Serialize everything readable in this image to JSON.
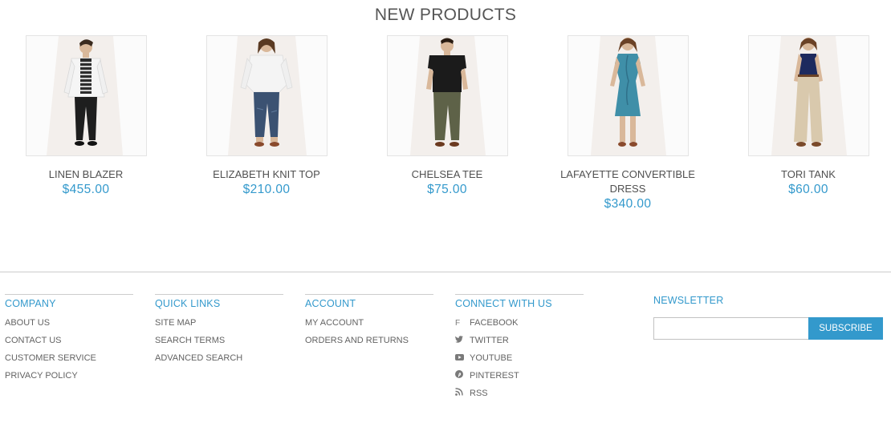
{
  "section": {
    "title": "NEW PRODUCTS"
  },
  "products": [
    {
      "name": "LINEN BLAZER",
      "price": "$455.00",
      "image": "linen-blazer-photo"
    },
    {
      "name": "ELIZABETH KNIT TOP",
      "price": "$210.00",
      "image": "elizabeth-knit-top-photo"
    },
    {
      "name": "CHELSEA TEE",
      "price": "$75.00",
      "image": "chelsea-tee-photo"
    },
    {
      "name": "LAFAYETTE CONVERTIBLE DRESS",
      "price": "$340.00",
      "image": "lafayette-dress-photo"
    },
    {
      "name": "TORI TANK",
      "price": "$60.00",
      "image": "tori-tank-photo"
    }
  ],
  "footer": {
    "company": {
      "heading": "COMPANY",
      "links": [
        "ABOUT US",
        "CONTACT US",
        "CUSTOMER SERVICE",
        "PRIVACY POLICY"
      ]
    },
    "quick_links": {
      "heading": "QUICK LINKS",
      "links": [
        "SITE MAP",
        "SEARCH TERMS",
        "ADVANCED SEARCH"
      ]
    },
    "account": {
      "heading": "ACCOUNT",
      "links": [
        "MY ACCOUNT",
        "ORDERS AND RETURNS"
      ]
    },
    "connect": {
      "heading": "CONNECT WITH US",
      "links": [
        {
          "label": "FACEBOOK",
          "icon": "facebook-icon"
        },
        {
          "label": "TWITTER",
          "icon": "twitter-icon"
        },
        {
          "label": "YOUTUBE",
          "icon": "youtube-icon"
        },
        {
          "label": "PINTEREST",
          "icon": "pinterest-icon"
        },
        {
          "label": "RSS",
          "icon": "rss-icon"
        }
      ]
    },
    "newsletter": {
      "heading": "NEWSLETTER",
      "input_value": "",
      "button_label": "SUBSCRIBE"
    }
  },
  "colors": {
    "accent": "#3399cc",
    "text": "#636363",
    "border": "#cccccc"
  }
}
